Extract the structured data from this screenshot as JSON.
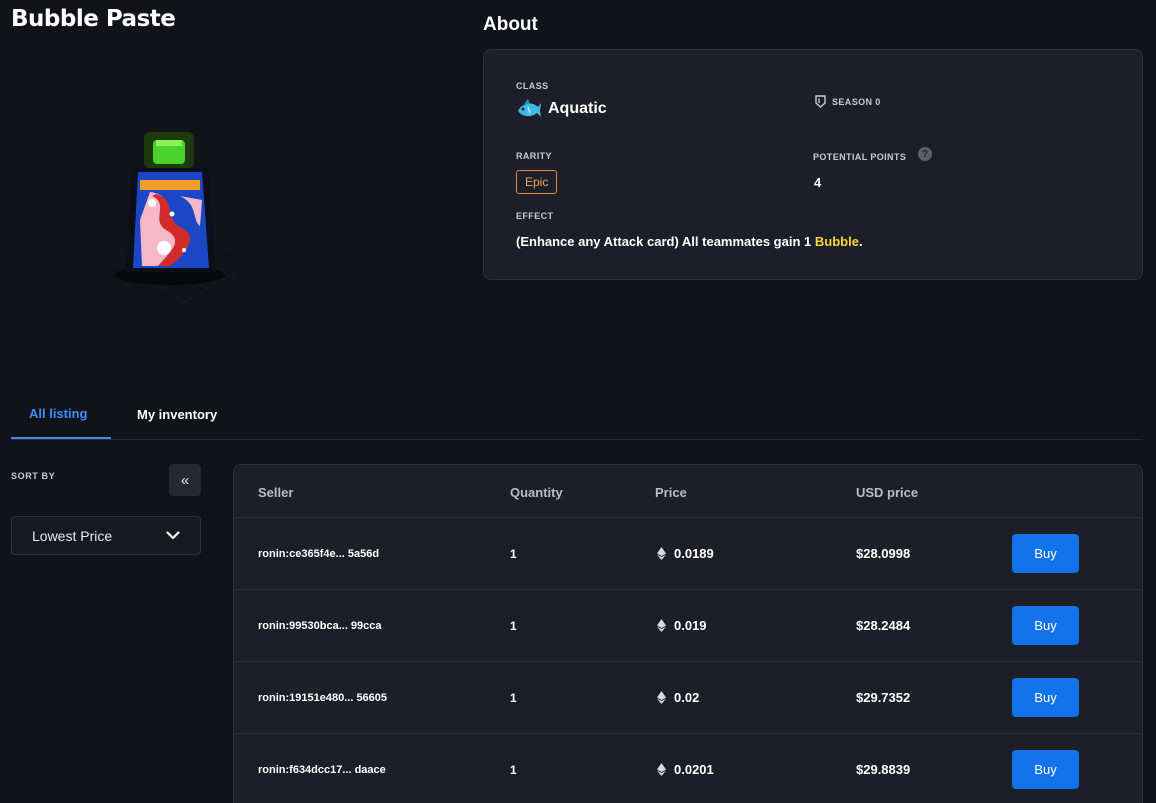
{
  "item": {
    "name": "Bubble Paste"
  },
  "about": {
    "title": "About",
    "class_label": "CLASS",
    "class_value": "Aquatic",
    "season_label": "SEASON 0",
    "rarity_label": "RARITY",
    "rarity_value": "Epic",
    "potential_points_label": "POTENTIAL POINTS",
    "potential_points_help": "?",
    "potential_points_value": "4",
    "effect_label": "EFFECT",
    "effect_prefix": "(Enhance any Attack card) All teammates gain ",
    "effect_amount": "1",
    "effect_highlight": "Bubble",
    "effect_suffix": "."
  },
  "tabs": [
    {
      "label": "All listing",
      "active": true
    },
    {
      "label": "My inventory",
      "active": false
    }
  ],
  "sort": {
    "label": "SORT BY",
    "collapse_icon": "«",
    "selected": "Lowest Price"
  },
  "table": {
    "headers": {
      "seller": "Seller",
      "quantity": "Quantity",
      "price": "Price",
      "usd": "USD price"
    },
    "rows": [
      {
        "seller": "ronin:ce365f4e... 5a56d",
        "quantity": "1",
        "price": "0.0189",
        "usd": "$28.0998",
        "action": "Buy"
      },
      {
        "seller": "ronin:99530bca... 99cca",
        "quantity": "1",
        "price": "0.019",
        "usd": "$28.2484",
        "action": "Buy"
      },
      {
        "seller": "ronin:19151e480... 56605",
        "quantity": "1",
        "price": "0.02",
        "usd": "$29.7352",
        "action": "Buy"
      },
      {
        "seller": "ronin:f634dcc17... daace",
        "quantity": "1",
        "price": "0.0201",
        "usd": "$29.8839",
        "action": "Buy"
      }
    ]
  },
  "colors": {
    "background": "#111318",
    "card": "#1c1f27",
    "accent_blue": "#3e8bff",
    "buy_button": "#1273ea",
    "rarity_epic": "#e8873a",
    "effect_highlight": "#f7d43b"
  },
  "icons": {
    "class_icon": "fish-icon",
    "season_icon": "shield-icon",
    "help_icon": "question-icon",
    "price_icon": "ethereum-icon",
    "dropdown_icon": "chevron-down-icon",
    "collapse_icon": "double-chevron-left-icon"
  }
}
